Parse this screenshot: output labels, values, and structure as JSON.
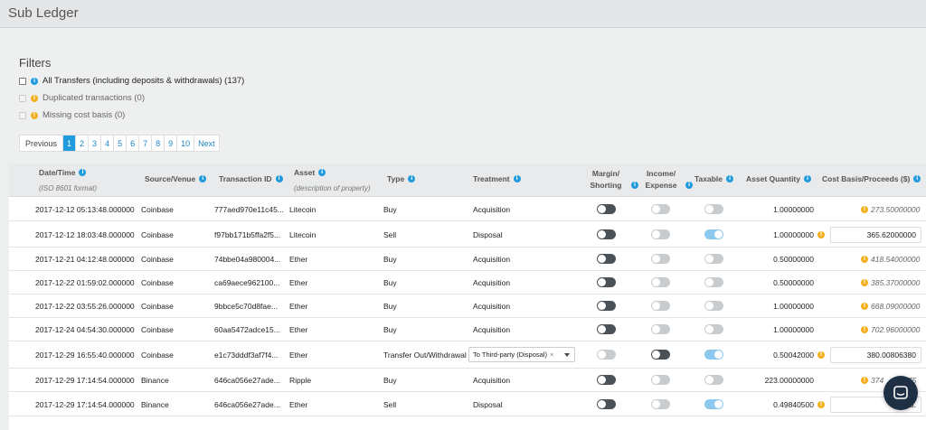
{
  "page": {
    "title": "Sub Ledger"
  },
  "filters": {
    "title": "Filters",
    "items": [
      {
        "label": "All Transfers (including deposits & withdrawals) (137)",
        "icon": "info-icon",
        "checked": false,
        "enabled": true
      },
      {
        "label": "Duplicated transactions (0)",
        "icon": "warning-icon",
        "checked": false,
        "enabled": false
      },
      {
        "label": "Missing cost basis (0)",
        "icon": "warning-icon",
        "checked": false,
        "enabled": false
      }
    ]
  },
  "pagination": {
    "previous": "Previous",
    "pages": [
      "1",
      "2",
      "3",
      "4",
      "5",
      "6",
      "7",
      "8",
      "9",
      "10"
    ],
    "active": "1",
    "next": "Next"
  },
  "table": {
    "headers": {
      "datetime": "Date/Time",
      "datetime_sub": "(ISO 8601 format)",
      "source": "Source/Venue",
      "txid": "Transaction ID",
      "asset": "Asset",
      "asset_sub": "(description of property)",
      "type": "Type",
      "treatment": "Treatment",
      "margin_1": "Margin/",
      "margin_2": "Shorting",
      "income_1": "Income/",
      "income_2": "Expense",
      "taxable": "Taxable",
      "quantity": "Asset Quantity",
      "cost": "Cost Basis/Proceeds ($)"
    },
    "rows": [
      {
        "datetime": "2017-12-12 05:13:48.000000",
        "source": "Coinbase",
        "txid": "777aed970e11c45...",
        "asset": "Litecoin",
        "type": "Buy",
        "treatment": "Acquisition",
        "margin": "off",
        "income": "disabled",
        "taxable": "disabled",
        "quantity": "1.00000000",
        "cost": "273.50000000",
        "cost_style": "italic"
      },
      {
        "datetime": "2017-12-12 18:03:48.000000",
        "source": "Coinbase",
        "txid": "f97bb171b5ffa2f5...",
        "asset": "Litecoin",
        "type": "Sell",
        "treatment": "Disposal",
        "margin": "off",
        "income": "disabled",
        "taxable": "on",
        "quantity": "1.00000000",
        "cost": "365.62000000",
        "cost_style": "box"
      },
      {
        "datetime": "2017-12-21 04:12:48.000000",
        "source": "Coinbase",
        "txid": "74bbe04a980004...",
        "asset": "Ether",
        "type": "Buy",
        "treatment": "Acquisition",
        "margin": "off",
        "income": "disabled",
        "taxable": "disabled",
        "quantity": "0.50000000",
        "cost": "418.54000000",
        "cost_style": "italic"
      },
      {
        "datetime": "2017-12-22 01:59:02.000000",
        "source": "Coinbase",
        "txid": "ca69aece962100...",
        "asset": "Ether",
        "type": "Buy",
        "treatment": "Acquisition",
        "margin": "off",
        "income": "disabled",
        "taxable": "disabled",
        "quantity": "0.50000000",
        "cost": "385.37000000",
        "cost_style": "italic"
      },
      {
        "datetime": "2017-12-22 03:55:26.000000",
        "source": "Coinbase",
        "txid": "9bbce5c70d8fae...",
        "asset": "Ether",
        "type": "Buy",
        "treatment": "Acquisition",
        "margin": "off",
        "income": "disabled",
        "taxable": "disabled",
        "quantity": "1.00000000",
        "cost": "668.09000000",
        "cost_style": "italic"
      },
      {
        "datetime": "2017-12-24 04:54:30.000000",
        "source": "Coinbase",
        "txid": "60aa5472adce15...",
        "asset": "Ether",
        "type": "Buy",
        "treatment": "Acquisition",
        "margin": "off",
        "income": "disabled",
        "taxable": "disabled",
        "quantity": "1.00000000",
        "cost": "702.96000000",
        "cost_style": "italic"
      },
      {
        "datetime": "2017-12-29 16:55:40.000000",
        "source": "Coinbase",
        "txid": "e1c73dddf3af7f4...",
        "asset": "Ether",
        "type": "Transfer Out/Withdrawal",
        "treatment_select": "To Third-party (Disposal)",
        "margin": "disabled",
        "income": "off",
        "taxable": "on",
        "quantity": "0.50042000",
        "cost": "380.00806380",
        "cost_style": "box"
      },
      {
        "datetime": "2017-12-29 17:14:54.000000",
        "source": "Binance",
        "txid": "646ca056e27ade...",
        "asset": "Ripple",
        "type": "Buy",
        "treatment": "Acquisition",
        "margin": "off",
        "income": "disabled",
        "taxable": "disabled",
        "quantity": "223.00000000",
        "cost": "374",
        "cost_tail": "275",
        "cost_style": "italic"
      },
      {
        "datetime": "2017-12-29 17:14:54.000000",
        "source": "Binance",
        "txid": "646ca056e27ade...",
        "asset": "Ether",
        "type": "Sell",
        "treatment": "Disposal",
        "margin": "off",
        "income": "disabled",
        "taxable": "on",
        "quantity": "0.49840500",
        "cost": "373.",
        "cost_style": "box"
      }
    ]
  },
  "chat": {
    "icon": "chat-icon"
  },
  "colors": {
    "accent": "#1f9bde",
    "warning": "#f2b01e",
    "toggle_on": "#8dc8ee",
    "toggle_dark": "#4a5157",
    "chat": "#1f2f44"
  }
}
